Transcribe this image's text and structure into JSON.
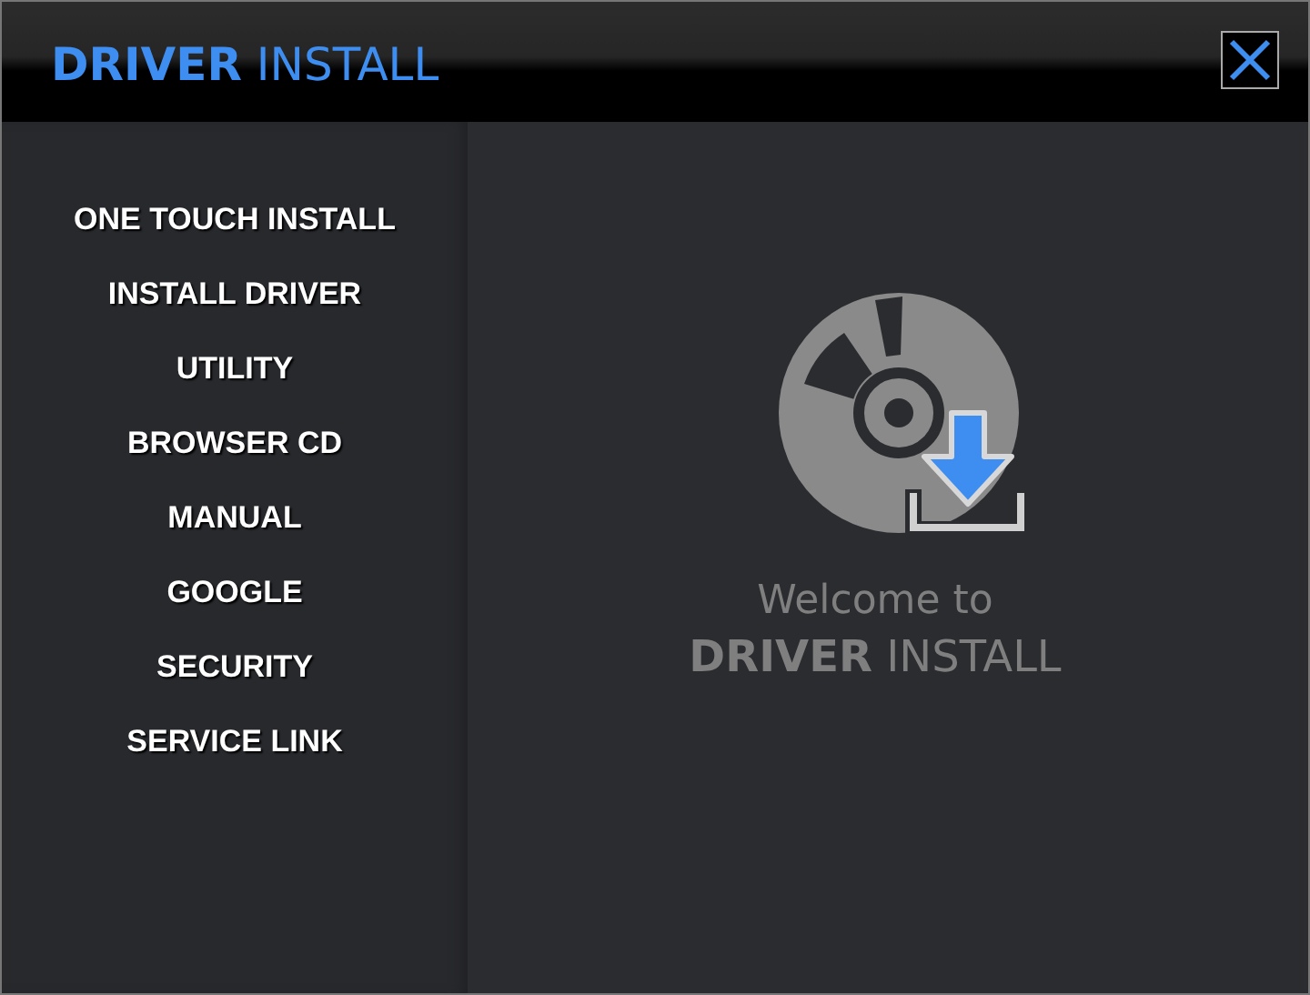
{
  "window": {
    "title": "**DRIVER** INSTALL"
  },
  "menu": [
    {
      "label": "ONE TOUCH INSTALL"
    },
    {
      "label": "INSTALL DRIVER"
    },
    {
      "label": "UTILITY"
    },
    {
      "label": "BROWSER CD"
    },
    {
      "label": "MANUAL"
    },
    {
      "label": "GOOGLE"
    },
    {
      "label": "SECURITY"
    },
    {
      "label": "SERVICE LINK"
    }
  ],
  "welcome": {
    "line_1": "Welcome to",
    "line_2": "**DRIVER** INSTALL"
  }
}
